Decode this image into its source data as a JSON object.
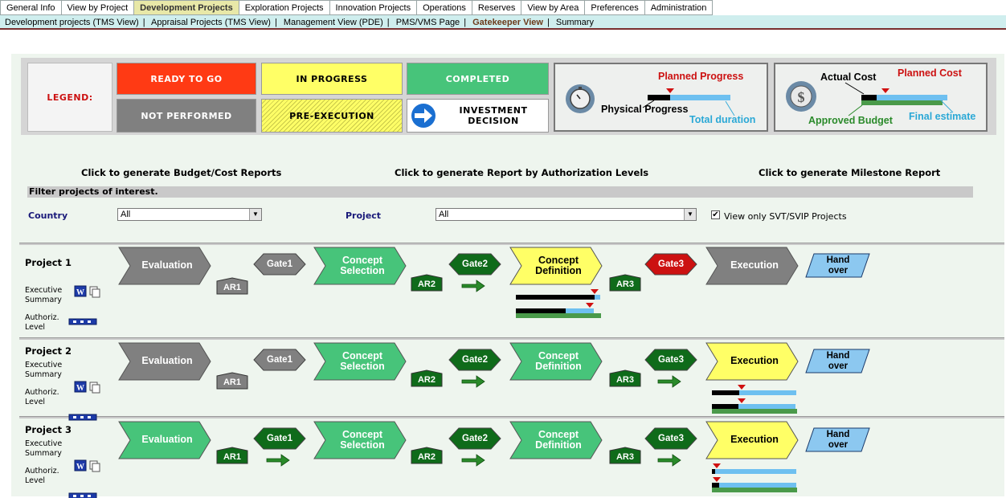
{
  "tabs": [
    "General Info",
    "View by Project",
    "Development Projects",
    "Exploration Projects",
    "Innovation Projects",
    "Operations",
    "Reserves",
    "View by Area",
    "Preferences",
    "Administration"
  ],
  "active_tab": "Development Projects",
  "subnav": [
    "Development projects (TMS View)",
    "Appraisal Projects (TMS View)",
    "Management View (PDE)",
    "PMS/VMS Page",
    "Gatekeeper View",
    "Summary"
  ],
  "active_subnav": "Gatekeeper View",
  "legend": {
    "title": "LEGEND:",
    "ready": "READY TO GO",
    "in_progress": "IN PROGRESS",
    "completed": "COMPLETED",
    "not_performed": "NOT PERFORMED",
    "pre_execution": "PRE-EXECUTION",
    "investment_1": "INVESTMENT",
    "investment_2": "DECISION",
    "planned_progress": "Planned Progress",
    "physical_progress": "Physical Progress",
    "total_duration": "Total duration",
    "actual_cost": "Actual Cost",
    "planned_cost": "Planned Cost",
    "approved_budget": "Approved Budget",
    "final_estimate": "Final estimate",
    "colors": {
      "ready": "#ff3a14",
      "in_progress": "#ffff66",
      "completed": "#47c47a",
      "not_performed": "#808080"
    }
  },
  "reports": {
    "budget": "Click to generate Budget/Cost Reports",
    "authorization": "Click to generate Report by Authorization Levels",
    "milestone": "Click to generate Milestone Report"
  },
  "filter": {
    "title": "Filter projects of interest.",
    "country_label": "Country",
    "country_value": "All",
    "project_label": "Project",
    "project_value": "All",
    "svt_label": "View only SVT/SVIP Projects",
    "svt_checked": true
  },
  "row_labels": {
    "exec1": "Executive",
    "exec2": "Summary",
    "auth1": "Authoriz.",
    "auth2": "Level"
  },
  "phase_names": {
    "evaluation": "Evaluation",
    "cs1": "Concept",
    "cs2": "Selection",
    "cd1": "Concept",
    "cd2": "Definition",
    "execution": "Execution",
    "ho1": "Hand",
    "ho2": "over"
  },
  "gates": [
    "Gate1",
    "Gate2",
    "Gate3"
  ],
  "ars": [
    "AR1",
    "AR2",
    "AR3"
  ],
  "projects": [
    {
      "name": "Project  1"
    },
    {
      "name": "Project  2"
    },
    {
      "name": "Project  3"
    }
  ]
}
